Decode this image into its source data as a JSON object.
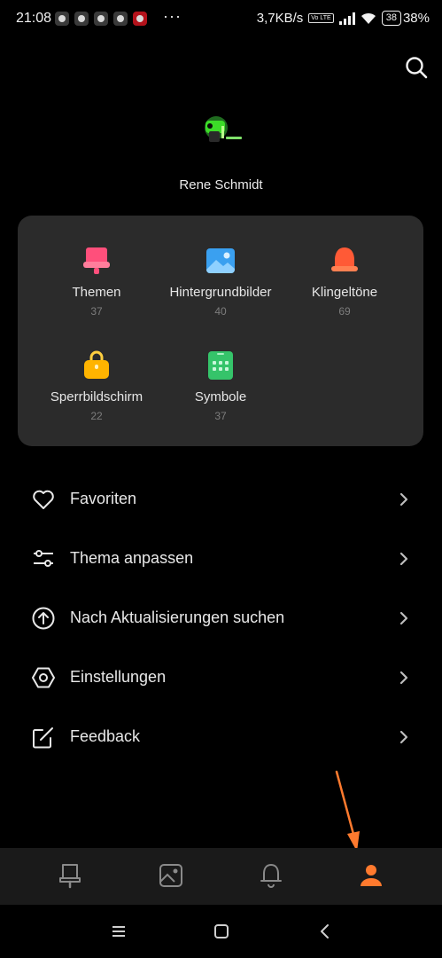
{
  "status_bar": {
    "time": "21:08",
    "more": "···",
    "network_speed": "3,7KB/s",
    "volte": "Vo LTE",
    "battery": "38",
    "battery_percent": "38%"
  },
  "profile": {
    "username": "Rene Schmidt",
    "avatar_icon": "android-avatar-icon"
  },
  "categories": [
    {
      "label": "Themen",
      "count": "37",
      "icon": "theme-icon",
      "color": "#ff4f7b"
    },
    {
      "label": "Hintergrundbilder",
      "count": "40",
      "icon": "wallpaper-icon",
      "color": "#3aa0f0"
    },
    {
      "label": "Klingeltöne",
      "count": "69",
      "icon": "bell-icon",
      "color": "#ff5a36"
    },
    {
      "label": "Sperrbildschirm",
      "count": "22",
      "icon": "lock-icon",
      "color": "#ffb400"
    },
    {
      "label": "Symbole",
      "count": "37",
      "icon": "icons-icon",
      "color": "#35c46a"
    }
  ],
  "menu": [
    {
      "label": "Favoriten",
      "icon": "heart-icon"
    },
    {
      "label": "Thema anpassen",
      "icon": "sliders-icon"
    },
    {
      "label": "Nach Aktualisierungen suchen",
      "icon": "update-icon"
    },
    {
      "label": "Einstellungen",
      "icon": "settings-icon"
    },
    {
      "label": "Feedback",
      "icon": "feedback-icon"
    }
  ],
  "bottom_nav": [
    {
      "icon": "theme-tab-icon",
      "active": false
    },
    {
      "icon": "wallpaper-tab-icon",
      "active": false
    },
    {
      "icon": "ringtone-tab-icon",
      "active": false
    },
    {
      "icon": "profile-tab-icon",
      "active": true
    }
  ],
  "colors": {
    "accent": "#ff7a2e",
    "card_bg": "#2b2b2b",
    "muted": "#7d7d7d"
  }
}
